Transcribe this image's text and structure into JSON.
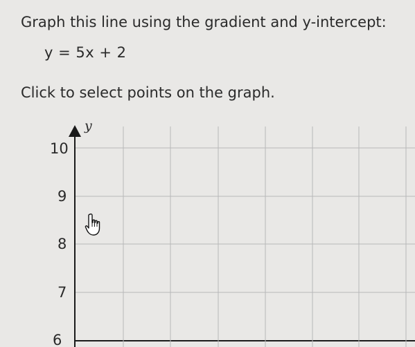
{
  "question": {
    "prompt": "Graph this line using the gradient and y-intercept:",
    "equation": "y = 5x + 2",
    "instruction": "Click to select points on the graph."
  },
  "graph": {
    "y_axis_label": "y",
    "y_ticks": [
      "10",
      "9",
      "8",
      "7",
      "6"
    ],
    "colors": {
      "grid": "#b8b8b8",
      "axis": "#1a1a1a",
      "background": "#e9e8e6"
    }
  },
  "cursor": {
    "icon": "pointer-hand-icon"
  }
}
